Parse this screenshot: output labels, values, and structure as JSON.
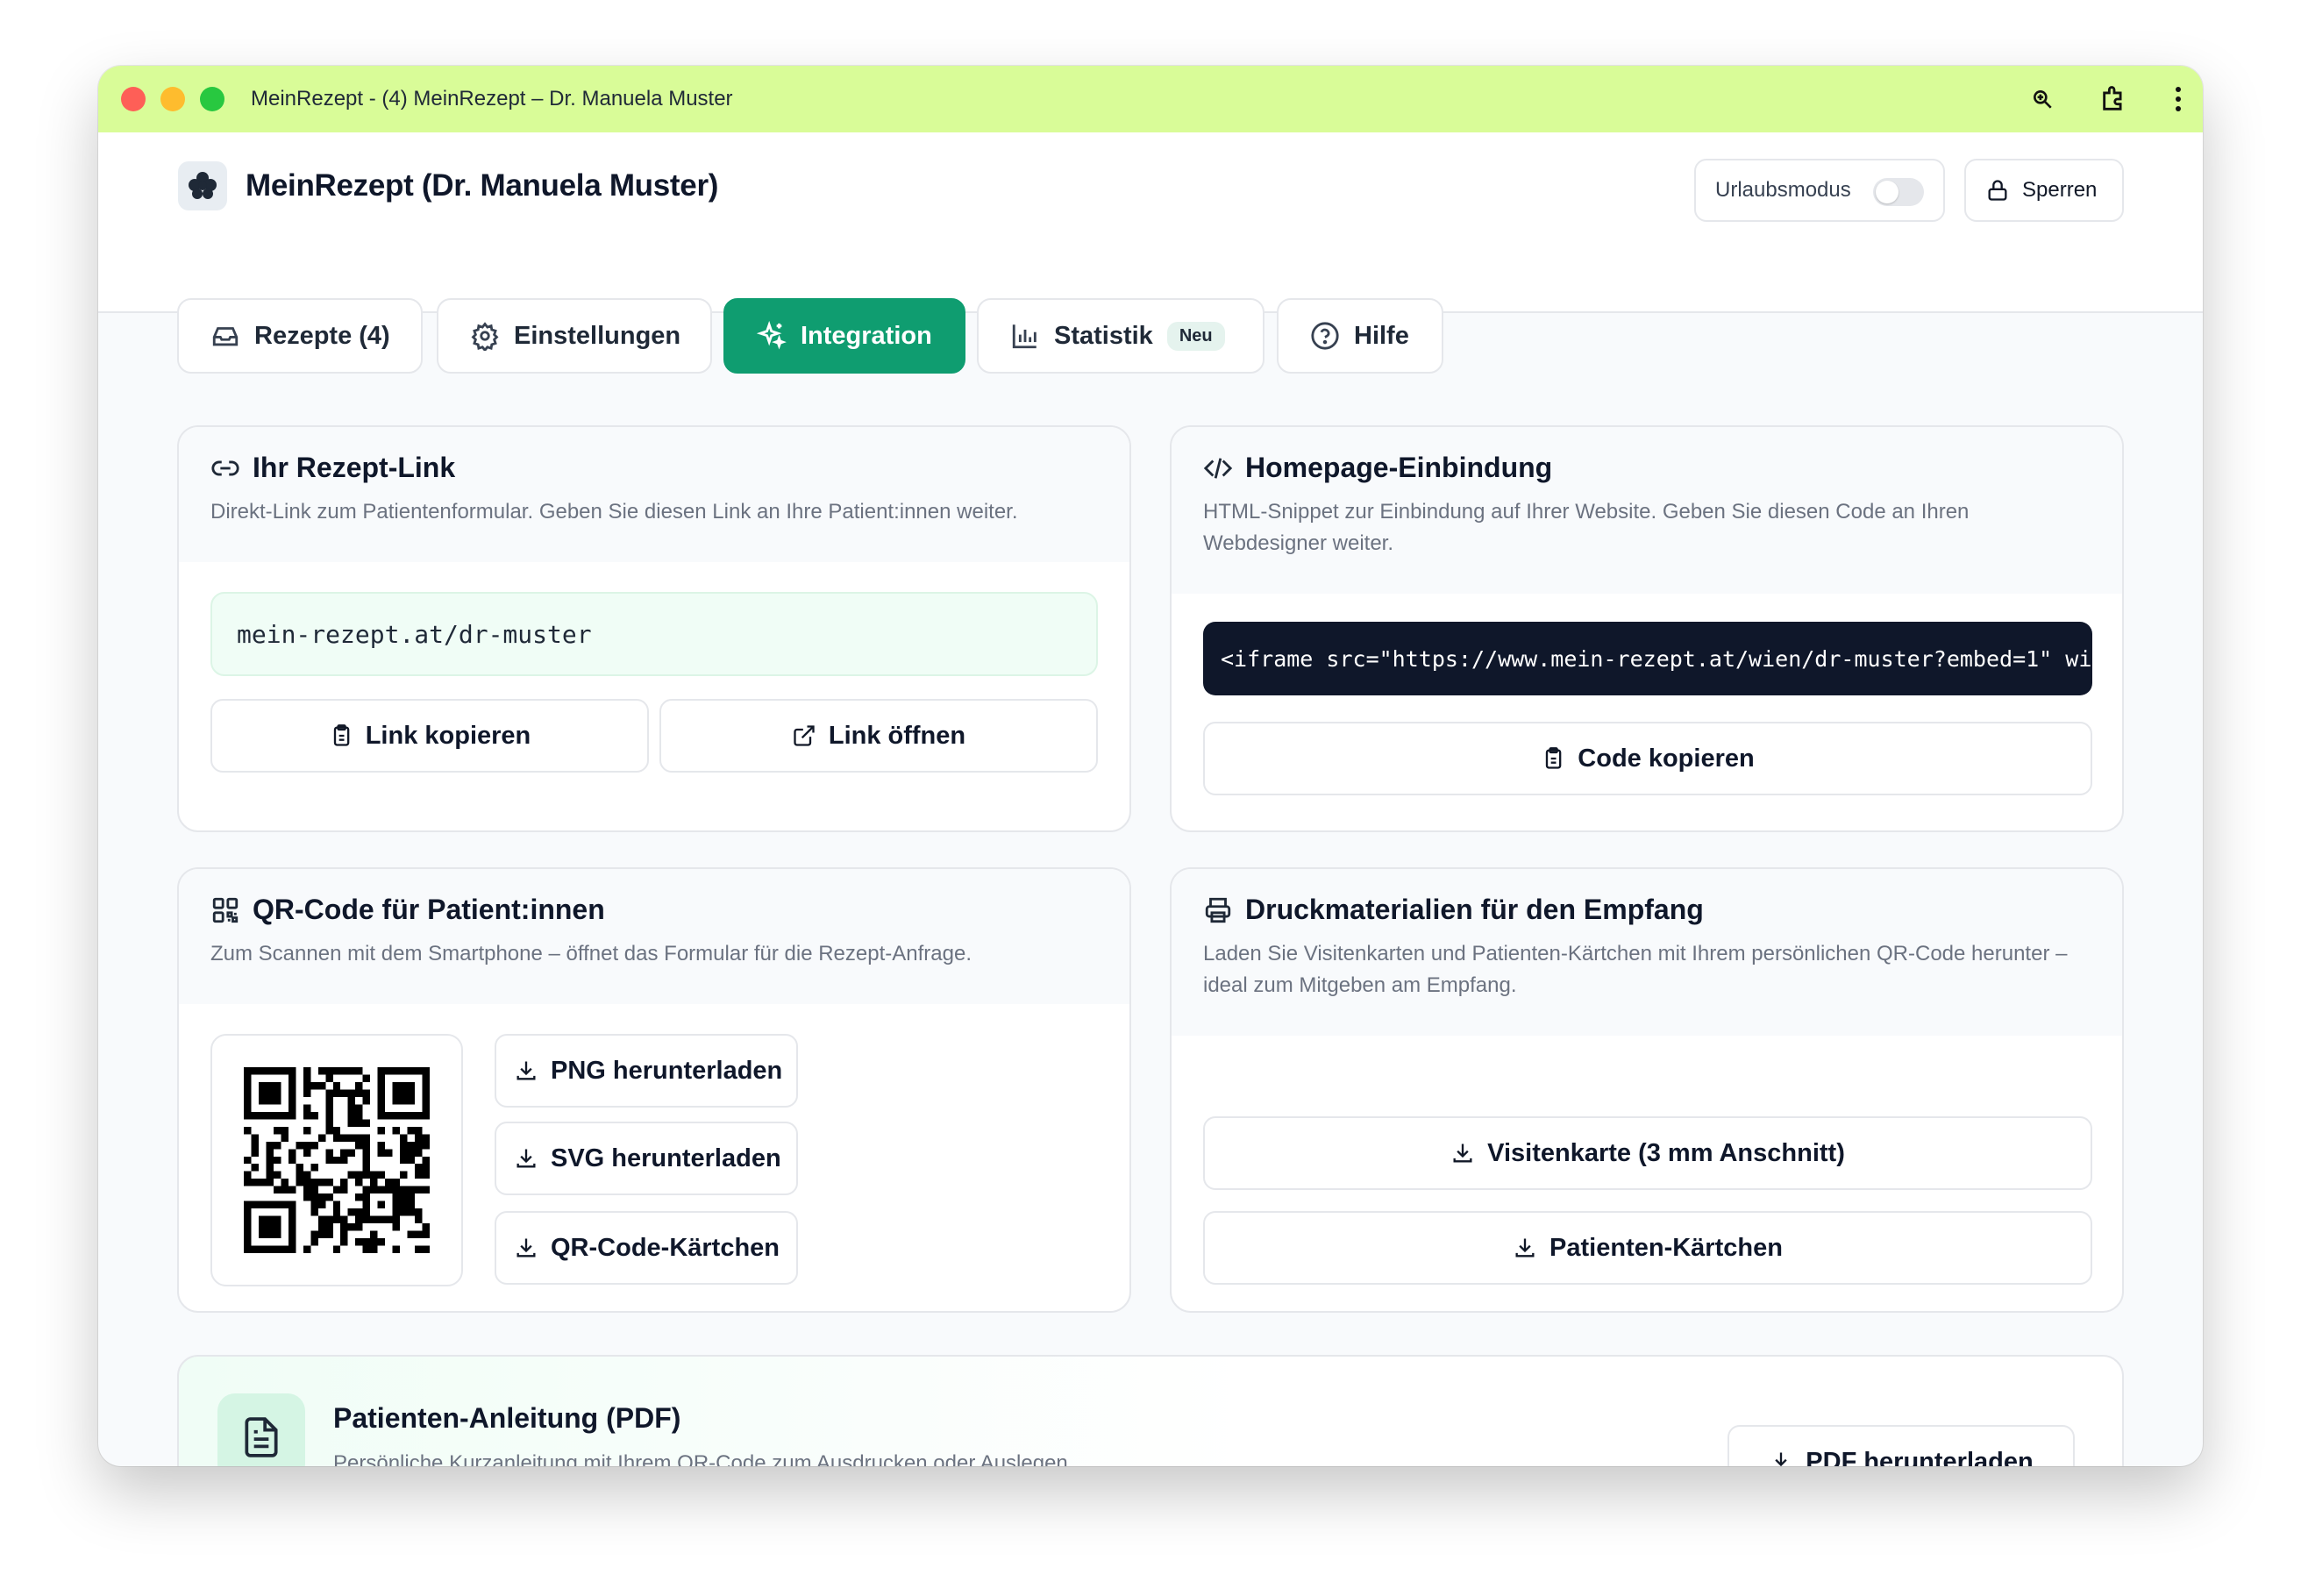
{
  "window": {
    "title": "MeinRezept - (4) MeinRezept – Dr. Manuela Muster"
  },
  "header": {
    "app_title": "MeinRezept (Dr. Manuela Muster)",
    "vacation_label": "Urlaubsmodus",
    "vacation_on": false,
    "lock_label": "Sperren"
  },
  "tabs": [
    {
      "label": "Rezepte (4)",
      "icon": "inbox-icon"
    },
    {
      "label": "Einstellungen",
      "icon": "gear-icon"
    },
    {
      "label": "Integration",
      "icon": "sparkles-icon",
      "active": true
    },
    {
      "label": "Statistik",
      "icon": "bar-chart-icon",
      "badge": "Neu"
    },
    {
      "label": "Hilfe",
      "icon": "help-circle-icon"
    }
  ],
  "link_card": {
    "title": "Ihr Rezept-Link",
    "description": "Direkt-Link zum Patientenformular. Geben Sie diesen Link an Ihre Patient:innen weiter.",
    "url": "mein-rezept.at/dr-muster",
    "copy_label": "Link kopieren",
    "open_label": "Link öffnen"
  },
  "homepage_card": {
    "title": "Homepage-Einbindung",
    "description": "HTML-Snippet zur Einbindung auf Ihrer Website. Geben Sie diesen Code an Ihren Webdesigner weiter.",
    "code": "<iframe src=\"https://www.mein-rezept.at/wien/dr-muster?embed=1\" wi",
    "copy_label": "Code kopieren"
  },
  "qr_card": {
    "title": "QR-Code für Patient:innen",
    "description": "Zum Scannen mit dem Smartphone – öffnet das Formular für die Rezept-Anfrage.",
    "png_label": "PNG herunterladen",
    "svg_label": "SVG herunterladen",
    "card_label": "QR-Code-Kärtchen"
  },
  "print_card": {
    "title": "Druckmaterialien für den Empfang",
    "description": "Laden Sie Visitenkarten und Patienten-Kärtchen mit Ihrem persönlichen QR-Code herunter – ideal zum Mitgeben am Empfang.",
    "business_card_label": "Visitenkarte (3 mm Anschnitt)",
    "patient_card_label": "Patienten-Kärtchen"
  },
  "pdf_card": {
    "title": "Patienten-Anleitung (PDF)",
    "description": "Persönliche Kurzanleitung mit Ihrem QR-Code zum Ausdrucken oder Auslegen.",
    "download_label": "PDF herunterladen"
  },
  "colors": {
    "titlebar": "#d9fc98",
    "accent": "#0f9d70",
    "code_bg": "#0f172a"
  }
}
